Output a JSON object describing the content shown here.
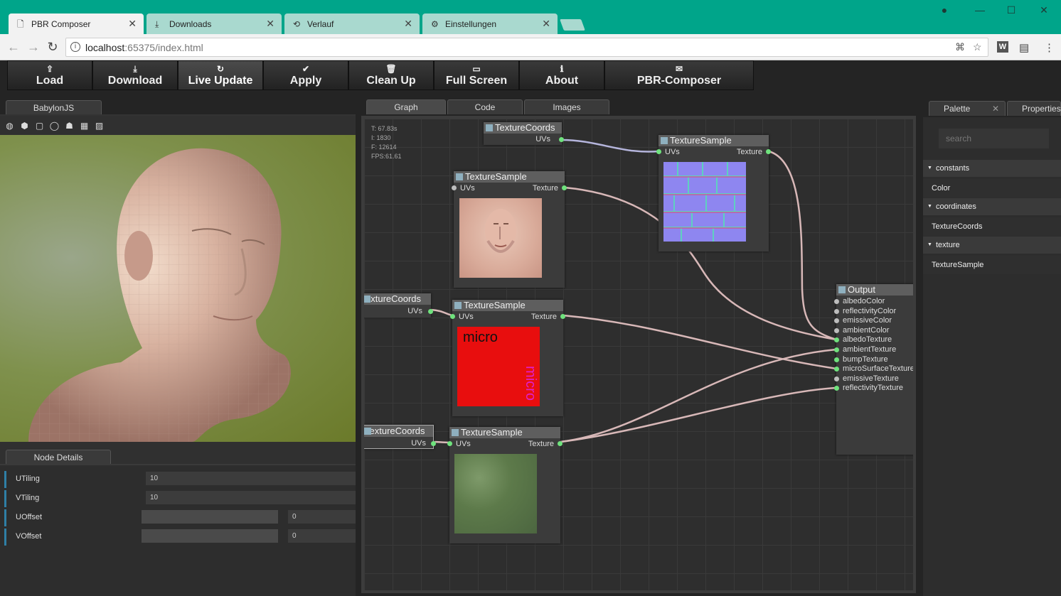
{
  "browser": {
    "tabs": [
      {
        "label": "PBR Composer",
        "icon": "page-icon",
        "active": true
      },
      {
        "label": "Downloads",
        "icon": "download-icon"
      },
      {
        "label": "Verlauf",
        "icon": "history-icon"
      },
      {
        "label": "Einstellungen",
        "icon": "gear-icon"
      }
    ],
    "url_host": "localhost",
    "url_rest": ":65375/index.html"
  },
  "menu": {
    "items": [
      {
        "label": "Load",
        "icon": "upload-icon"
      },
      {
        "label": "Download",
        "icon": "download-icon"
      },
      {
        "label": "Live Update",
        "icon": "refresh-icon"
      },
      {
        "label": "Apply",
        "icon": "check-icon"
      },
      {
        "label": "Clean Up",
        "icon": "trash-icon"
      },
      {
        "label": "Full Screen",
        "icon": "monitor-icon"
      },
      {
        "label": "About",
        "icon": "info-icon"
      },
      {
        "label": "PBR-Composer",
        "icon": "envelope-icon"
      }
    ]
  },
  "viewport": {
    "tab_label": "BabylonJS",
    "tools": [
      "globe-icon",
      "cube-icon",
      "square-icon",
      "circle-icon",
      "person-icon",
      "grid-icon",
      "image-icon"
    ]
  },
  "details": {
    "tab_label": "Node Details",
    "rows": [
      {
        "label": "UTiling",
        "value": "10"
      },
      {
        "label": "VTiling",
        "value": "10"
      },
      {
        "label": "UOffset",
        "value": "0"
      },
      {
        "label": "VOffset",
        "value": "0"
      }
    ]
  },
  "graph": {
    "tabs": [
      "Graph",
      "Code",
      "Images"
    ],
    "stats": {
      "t": "T: 67.83s",
      "i": "I: 1830",
      "f": "F: 12614",
      "fps": "FPS:61.61"
    },
    "node_titles": {
      "coords": "TextureCoords",
      "coords_cut": "extureCoords",
      "coords_cut2": "TextureCoords",
      "sample": "TextureSample",
      "output": "Output"
    },
    "port_labels": {
      "uvs": "UVs",
      "texture": "Texture"
    },
    "micro_text": "micro",
    "output_ports": [
      "albedoColor",
      "reflectivityColor",
      "emissiveColor",
      "ambientColor",
      "albedoTexture",
      "ambientTexture",
      "bumpTexture",
      "microSurfaceTexture",
      "emissiveTexture",
      "reflectivityTexture"
    ],
    "output_connected": [
      false,
      false,
      false,
      false,
      true,
      true,
      true,
      true,
      false,
      true
    ]
  },
  "palette": {
    "tabs": [
      "Palette",
      "Properties"
    ],
    "search_placeholder": "search",
    "categories": [
      {
        "label": "constants",
        "items": [
          "Color"
        ]
      },
      {
        "label": "coordinates",
        "items": [
          "TextureCoords"
        ]
      },
      {
        "label": "texture",
        "items": [
          "TextureSample"
        ]
      }
    ]
  }
}
